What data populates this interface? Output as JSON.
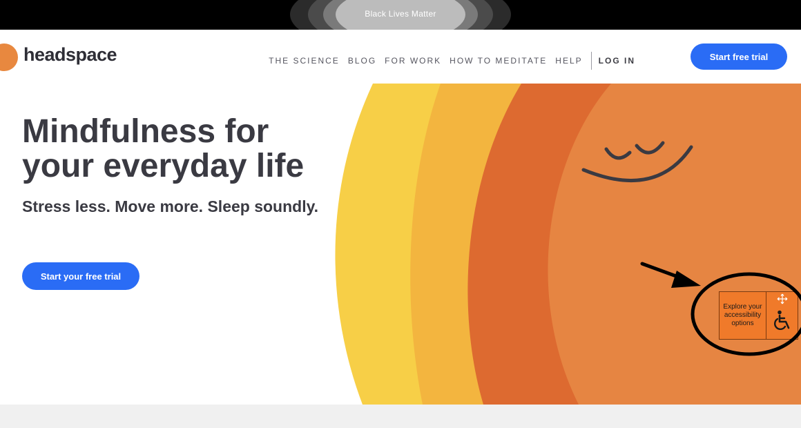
{
  "banner": {
    "text": "Black Lives Matter"
  },
  "header": {
    "logo_text": "headspace",
    "nav": [
      {
        "label": "THE SCIENCE"
      },
      {
        "label": "BLOG"
      },
      {
        "label": "FOR WORK"
      },
      {
        "label": "HOW TO MEDITATE"
      },
      {
        "label": "HELP"
      }
    ],
    "login_label": "LOG IN",
    "cta_label": "Start free trial"
  },
  "hero": {
    "title": "Mindfulness for your everyday life",
    "subtitle": "Stress less. Move more. Sleep soundly.",
    "cta_label": "Start your free trial"
  },
  "accessibility_widget": {
    "label": "Explore your accessibility options",
    "icons": [
      "move-icon",
      "wheelchair-icon"
    ]
  },
  "colors": {
    "accent": "#2a6cf5",
    "brand_orange": "#e8883f",
    "wave_yellow": "#f7cf47",
    "wave_light_orange": "#f3b53f",
    "wave_dark_orange": "#dd6a30",
    "widget_orange": "#f07a2a"
  }
}
